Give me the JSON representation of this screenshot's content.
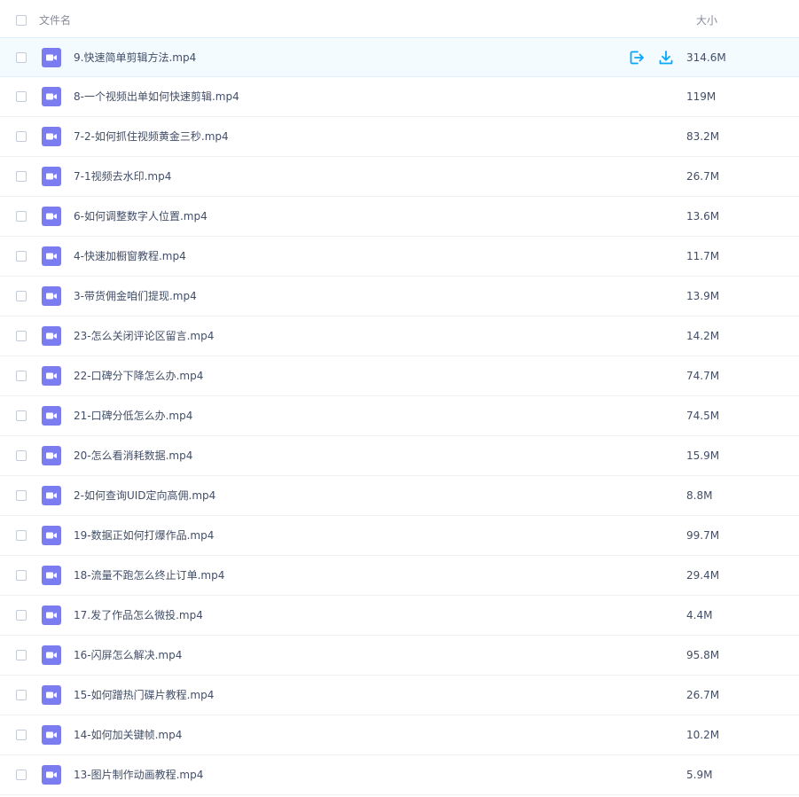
{
  "header": {
    "name_label": "文件名",
    "size_label": "大小"
  },
  "colors": {
    "accent": "#06a7ff",
    "video_icon": "#7b7cf0",
    "hover_row": "#f4fbff"
  },
  "files": [
    {
      "name": "9.快速简单剪辑方法.mp4",
      "size": "314.6M",
      "icon": "video-file-icon"
    },
    {
      "name": "8-一个视频出单如何快速剪辑.mp4",
      "size": "119M",
      "icon": "video-file-icon"
    },
    {
      "name": "7-2-如何抓住视频黄金三秒.mp4",
      "size": "83.2M",
      "icon": "video-file-icon"
    },
    {
      "name": "7-1视频去水印.mp4",
      "size": "26.7M",
      "icon": "video-file-icon"
    },
    {
      "name": "6-如何调整数字人位置.mp4",
      "size": "13.6M",
      "icon": "video-file-icon"
    },
    {
      "name": "4-快速加橱窗教程.mp4",
      "size": "11.7M",
      "icon": "video-file-icon"
    },
    {
      "name": "3-带货佣金咱们提现.mp4",
      "size": "13.9M",
      "icon": "video-file-icon"
    },
    {
      "name": "23-怎么关闭评论区留言.mp4",
      "size": "14.2M",
      "icon": "video-file-icon"
    },
    {
      "name": "22-口碑分下降怎么办.mp4",
      "size": "74.7M",
      "icon": "video-file-icon"
    },
    {
      "name": "21-口碑分低怎么办.mp4",
      "size": "74.5M",
      "icon": "video-file-icon"
    },
    {
      "name": "20-怎么看消耗数据.mp4",
      "size": "15.9M",
      "icon": "video-file-icon"
    },
    {
      "name": "2-如何查询UID定向高佣.mp4",
      "size": "8.8M",
      "icon": "video-file-icon"
    },
    {
      "name": "19-数据正如何打爆作品.mp4",
      "size": "99.7M",
      "icon": "video-file-icon"
    },
    {
      "name": "18-流量不跑怎么终止订单.mp4",
      "size": "29.4M",
      "icon": "video-file-icon"
    },
    {
      "name": "17.发了作品怎么微投.mp4",
      "size": "4.4M",
      "icon": "video-file-icon"
    },
    {
      "name": "16-闪屏怎么解决.mp4",
      "size": "95.8M",
      "icon": "video-file-icon"
    },
    {
      "name": "15-如何蹭热门碟片教程.mp4",
      "size": "26.7M",
      "icon": "video-file-icon"
    },
    {
      "name": "14-如何加关键帧.mp4",
      "size": "10.2M",
      "icon": "video-file-icon"
    },
    {
      "name": "13-图片制作动画教程.mp4",
      "size": "5.9M",
      "icon": "video-file-icon"
    }
  ],
  "hovered_row_actions": {
    "row_index": 0,
    "share_icon": "share-icon",
    "download_icon": "download-icon"
  }
}
